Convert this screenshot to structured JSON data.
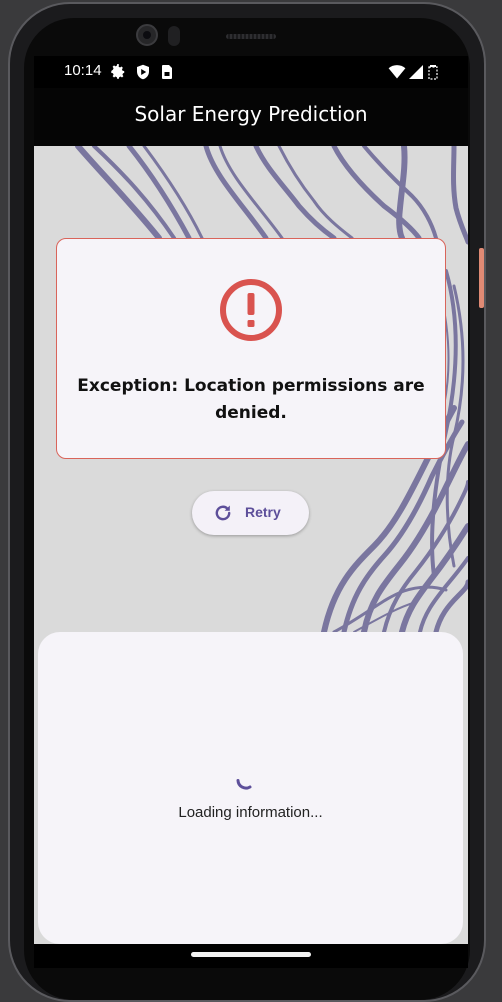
{
  "status_bar": {
    "time": "10:14",
    "left_icons": [
      "gear-icon",
      "shield-icon",
      "sim-card-icon"
    ],
    "right_icons": [
      "wifi-icon",
      "signal-icon",
      "battery-icon"
    ]
  },
  "app_bar": {
    "title": "Solar Energy Prediction"
  },
  "error_card": {
    "icon": "error-icon",
    "message": "Exception: Location permissions are denied.",
    "accent_color": "#d9534f"
  },
  "retry_button": {
    "icon": "refresh-icon",
    "label": "Retry"
  },
  "bottom_sheet": {
    "loading_text": "Loading information..."
  },
  "colors": {
    "primary": "#5d4f9a",
    "error": "#d9534f",
    "background": "#dadada",
    "card": "#f6f4f9"
  }
}
